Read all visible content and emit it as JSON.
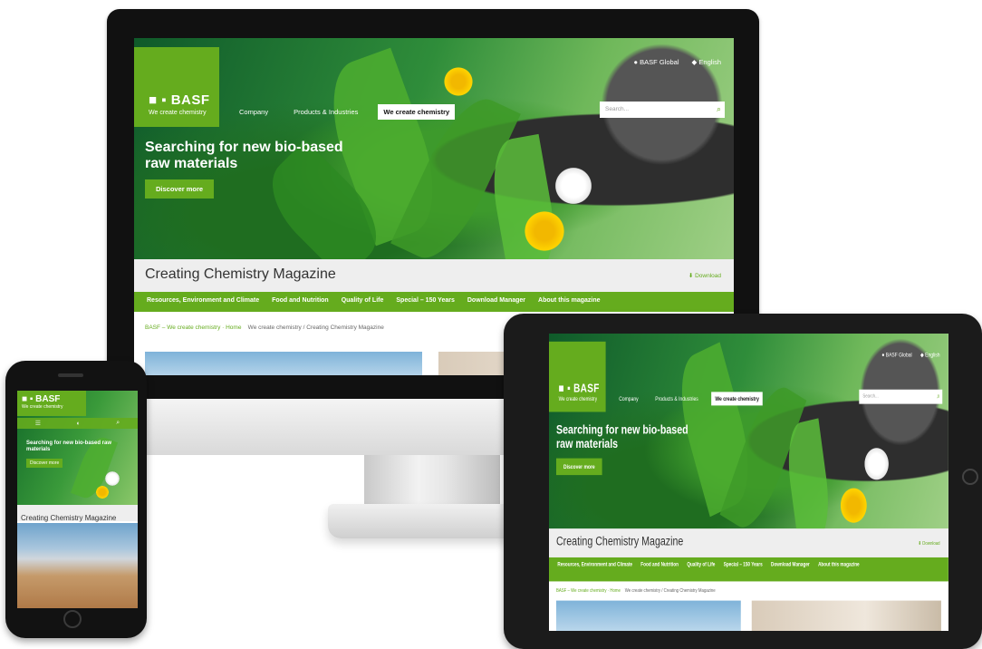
{
  "brand": {
    "logo": "■ ▪ BASF",
    "tagline": "We create chemistry",
    "accent": "#65ac1e"
  },
  "topbar": {
    "global": "BASF Global",
    "language": "English"
  },
  "nav": {
    "items": [
      "Company",
      "Products & Industries",
      "We create chemistry"
    ],
    "active": "We create chemistry"
  },
  "search": {
    "placeholder": "Search..."
  },
  "hero": {
    "title": "Searching for new bio-based raw materials",
    "button": "Discover more"
  },
  "magazine": {
    "title": "Creating Chemistry Magazine",
    "download": "Download",
    "nav": [
      "Resources, Environment and Climate",
      "Food and Nutrition",
      "Quality of Life",
      "Special – 150 Years",
      "Download Manager",
      "About this magazine"
    ]
  },
  "breadcrumb": {
    "parent": "BASF – We create chemistry · Home",
    "current": "We create chemistry / Creating Chemistry Magazine"
  },
  "phone": {
    "title": "Searching for new bio-based raw materials",
    "button": "Discover more",
    "magazine": "Creating Chemistry Magazine"
  }
}
